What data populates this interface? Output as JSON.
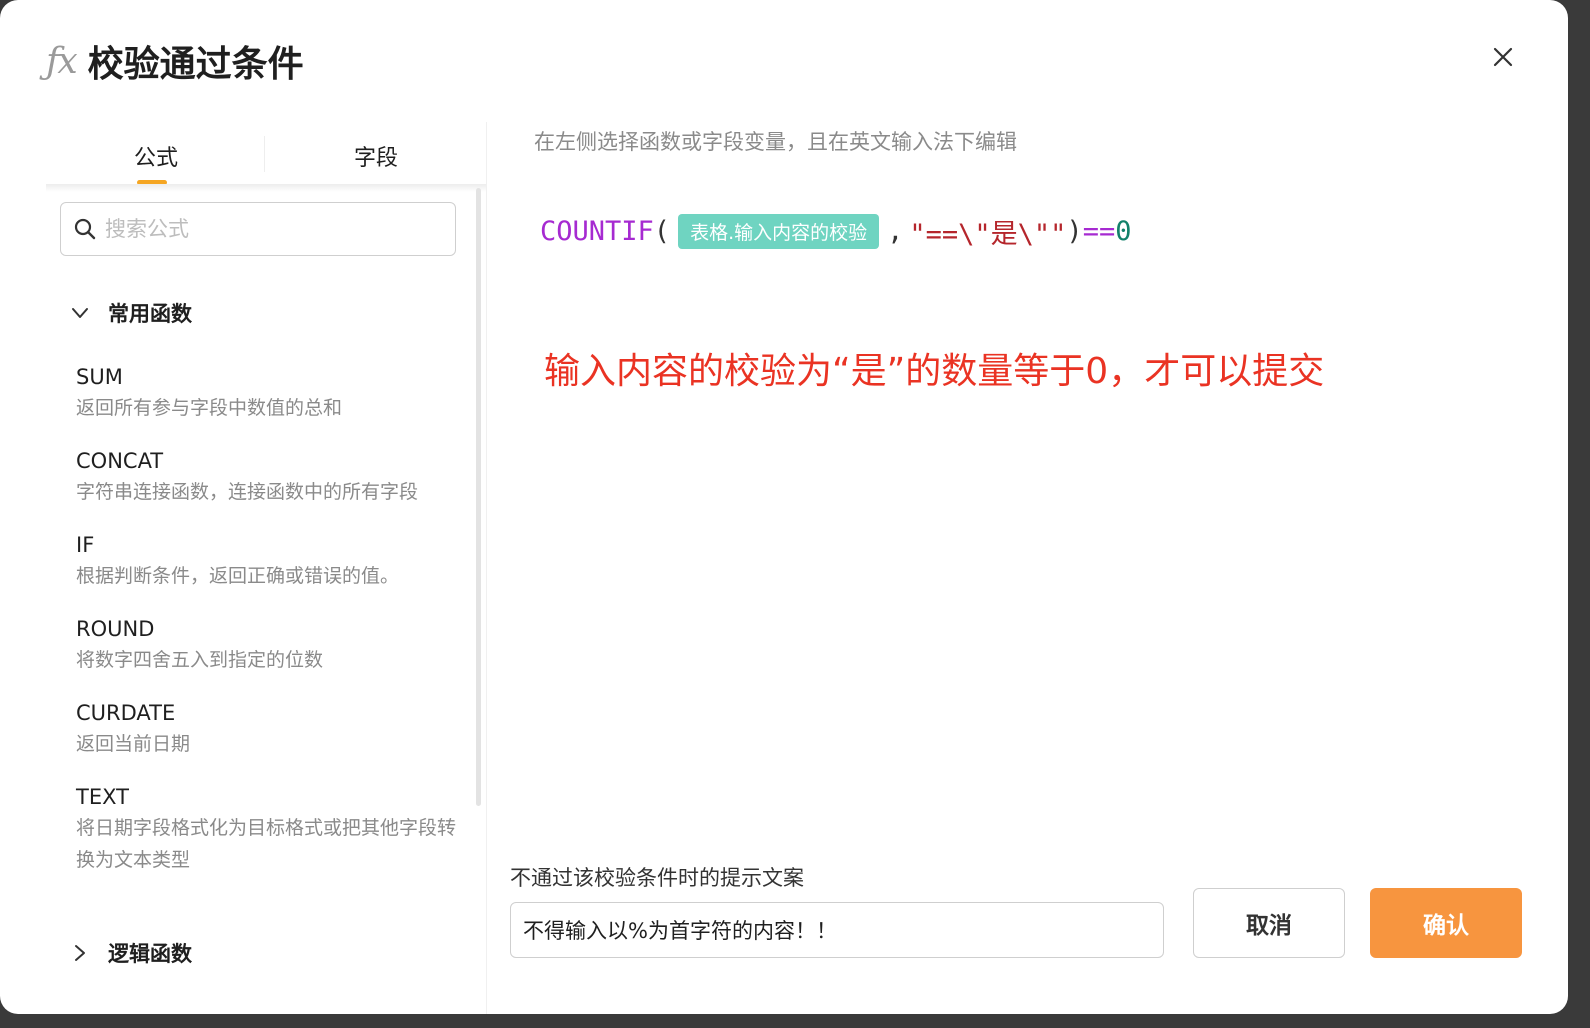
{
  "dialog": {
    "icon": "fx-icon",
    "title": "校验通过条件",
    "close_icon": "close-icon"
  },
  "left_panel": {
    "tabs": [
      {
        "label": "公式",
        "active": true
      },
      {
        "label": "字段",
        "active": false
      }
    ],
    "search": {
      "placeholder": "搜索公式",
      "value": ""
    },
    "groups": [
      {
        "title": "常用函数",
        "expanded": true,
        "icon": "chevron-down-icon"
      },
      {
        "title": "逻辑函数",
        "expanded": false,
        "icon": "chevron-right-icon"
      }
    ],
    "functions": [
      {
        "name": "SUM",
        "desc": "返回所有参与字段中数值的总和"
      },
      {
        "name": "CONCAT",
        "desc": "字符串连接函数，连接函数中的所有字段"
      },
      {
        "name": "IF",
        "desc": "根据判断条件，返回正确或错误的值。"
      },
      {
        "name": "ROUND",
        "desc": "将数字四舍五入到指定的位数"
      },
      {
        "name": "CURDATE",
        "desc": "返回当前日期"
      },
      {
        "name": "TEXT",
        "desc": "将日期字段格式化为目标格式或把其他字段转换为文本类型"
      }
    ]
  },
  "editor": {
    "hint": "在左侧选择函数或字段变量，且在英文输入法下编辑",
    "formula": {
      "function": "COUNTIF",
      "open_paren": "(",
      "field_chip": "表格.输入内容的校验",
      "comma": ",",
      "string_arg": "\"==\\\"是\\\"\"",
      "close_paren": ")",
      "operator": "==",
      "number": "0"
    },
    "annotation": "输入内容的校验为“是”的数量等于0，才可以提交"
  },
  "footer": {
    "fail_label": "不通过该校验条件时的提示文案",
    "fail_value": "不得输入以%为首字符的内容！！",
    "cancel_label": "取消",
    "confirm_label": "确认"
  },
  "colors": {
    "accent": "#f7953f",
    "tab_indicator": "#f5a623",
    "chip": "#6fd4c1",
    "annotation": "#ea3323",
    "function": "#a62ad1",
    "string": "#b5262c",
    "number": "#12816a"
  }
}
